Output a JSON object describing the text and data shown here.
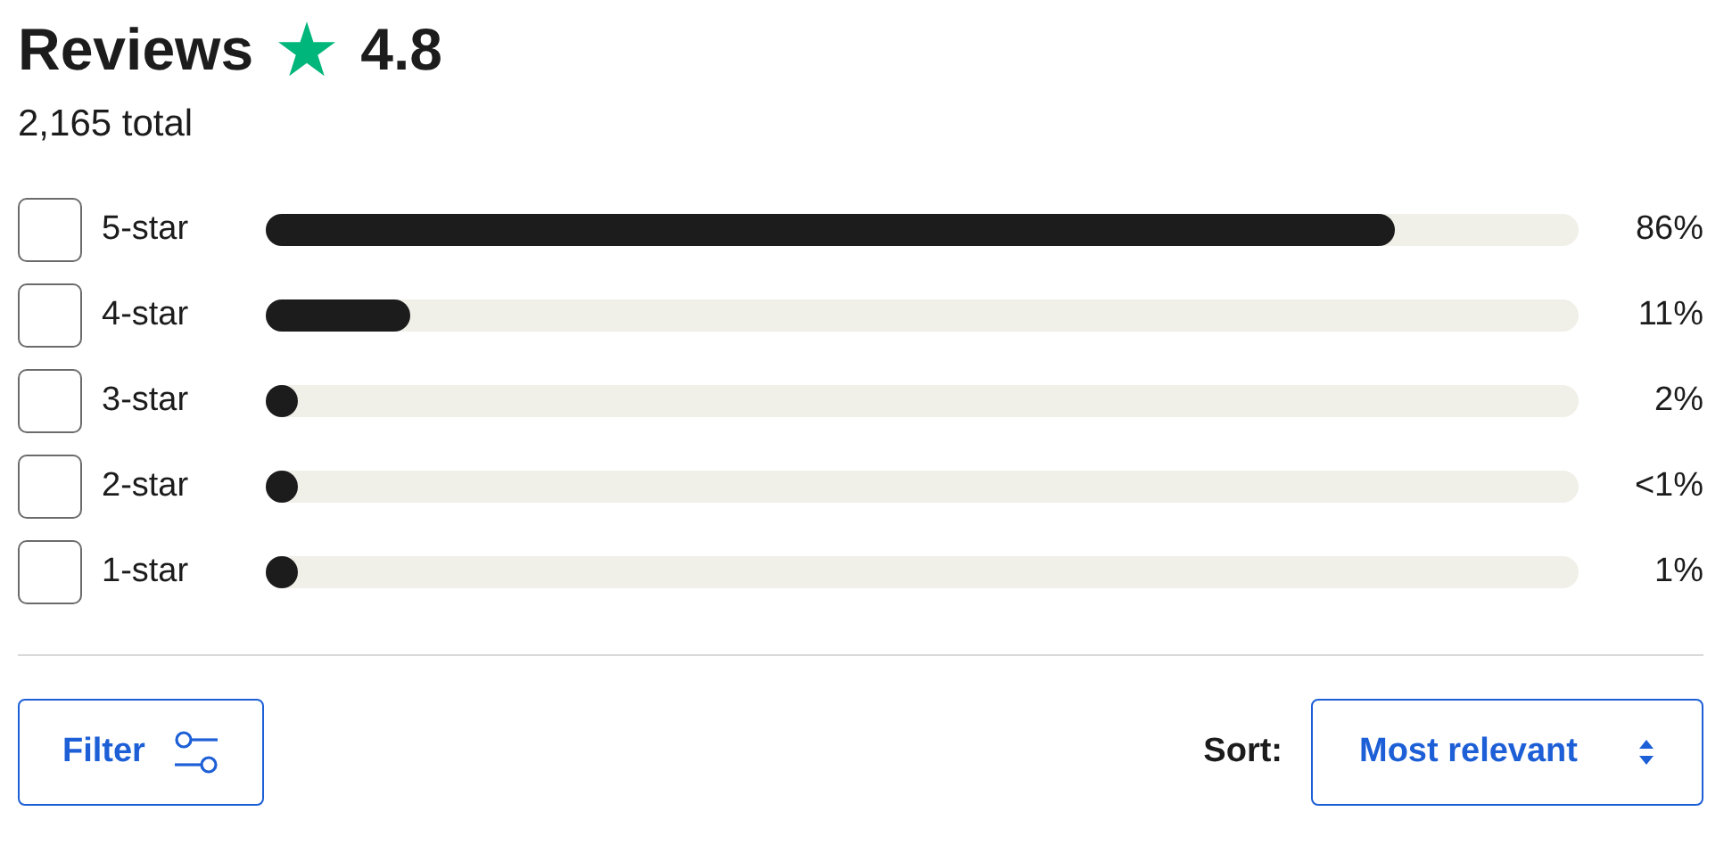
{
  "header": {
    "title": "Reviews",
    "rating": "4.8",
    "total": "2,165 total"
  },
  "distribution": [
    {
      "label": "5-star",
      "checked": false,
      "level": 0.86,
      "percent": "86%"
    },
    {
      "label": "4-star",
      "checked": false,
      "level": 0.11,
      "percent": "11%"
    },
    {
      "label": "3-star",
      "checked": false,
      "level": 0.02,
      "percent": "2%"
    },
    {
      "label": "2-star",
      "checked": false,
      "level": 0.005,
      "percent": "<1%"
    },
    {
      "label": "1-star",
      "checked": false,
      "level": 0.01,
      "percent": "1%"
    }
  ],
  "filter_button": {
    "label": "Filter"
  },
  "sort": {
    "label": "Sort:",
    "value": "Most relevant"
  }
}
